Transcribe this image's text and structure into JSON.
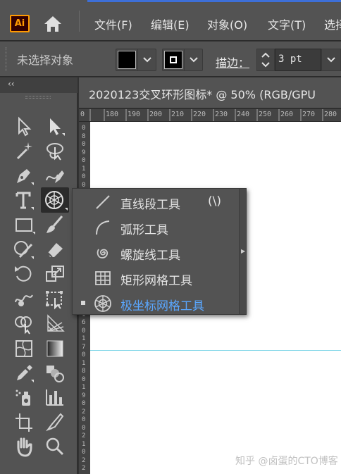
{
  "app": {
    "logo_text": "Ai",
    "brand_color": "#ff9a00"
  },
  "menubar": {
    "items": [
      "文件(F)",
      "编辑(E)",
      "对象(O)",
      "文字(T)",
      "选择"
    ]
  },
  "control_bar": {
    "selection_status": "未选择对象",
    "fill_color": "#000000",
    "stroke_label": "描边：",
    "stroke_value": "3 pt"
  },
  "document": {
    "tab_title": "2020123交叉环形图标* @ 50% (RGB/GPU",
    "ruler_ticks": [
      "0",
      "180",
      "190",
      "200",
      "210",
      "220",
      "230",
      "240",
      "250",
      "260",
      "270",
      "280"
    ],
    "vertical_ruler_digits": [
      "0",
      "8",
      "0",
      "9",
      "0",
      "1",
      "0",
      "0",
      "1",
      "1",
      "0",
      "1",
      "2",
      "0",
      "1",
      "3",
      "0",
      "1",
      "4",
      "0",
      "1",
      "5",
      "0",
      "1",
      "6",
      "0",
      "1",
      "7",
      "0",
      "1",
      "8",
      "0",
      "1",
      "9",
      "0",
      "2",
      "0",
      "0",
      "2",
      "1",
      "0",
      "2",
      "2"
    ]
  },
  "toolbar": {
    "collapse_label": "‹‹",
    "tools": [
      "selection-tool",
      "direct-selection-tool",
      "magic-wand-tool",
      "lasso-tool",
      "pen-tool",
      "curvature-tool",
      "type-tool",
      "polar-grid-tool",
      "rectangle-tool",
      "paintbrush-tool",
      "shaper-tool",
      "eraser-tool",
      "rotate-tool",
      "scale-tool",
      "warp-tool",
      "free-transform-tool",
      "shape-builder-tool",
      "perspective-grid-tool",
      "mesh-tool",
      "gradient-tool",
      "eyedropper-tool",
      "blend-tool",
      "symbol-sprayer-tool",
      "column-graph-tool",
      "artboard-tool",
      "slice-tool",
      "hand-tool",
      "zoom-tool"
    ]
  },
  "flyout": {
    "items": [
      {
        "label": "直线段工具",
        "shortcut": "(\\)",
        "icon": "line-segment-icon",
        "selected": false
      },
      {
        "label": "弧形工具",
        "shortcut": "",
        "icon": "arc-icon",
        "selected": false
      },
      {
        "label": "螺旋线工具",
        "shortcut": "",
        "icon": "spiral-icon",
        "selected": false
      },
      {
        "label": "矩形网格工具",
        "shortcut": "",
        "icon": "rectangular-grid-icon",
        "selected": false
      },
      {
        "label": "极坐标网格工具",
        "shortcut": "",
        "icon": "polar-grid-icon",
        "selected": true
      }
    ],
    "selected_color": "#5aa7ff"
  },
  "watermark": "知乎 @卤蛋的CTO博客",
  "guide_color": "#7fd6e8"
}
